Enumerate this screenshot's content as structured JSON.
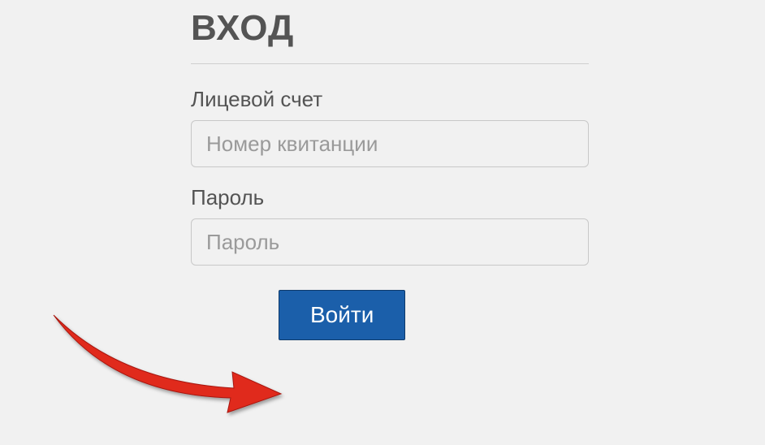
{
  "title": "ВХОД",
  "account": {
    "label": "Лицевой счет",
    "placeholder": "Номер квитанции",
    "value": ""
  },
  "password": {
    "label": "Пароль",
    "placeholder": "Пароль",
    "value": ""
  },
  "submit_label": "Войти",
  "colors": {
    "button_bg": "#1b5faa",
    "arrow": "#e02a1f"
  }
}
